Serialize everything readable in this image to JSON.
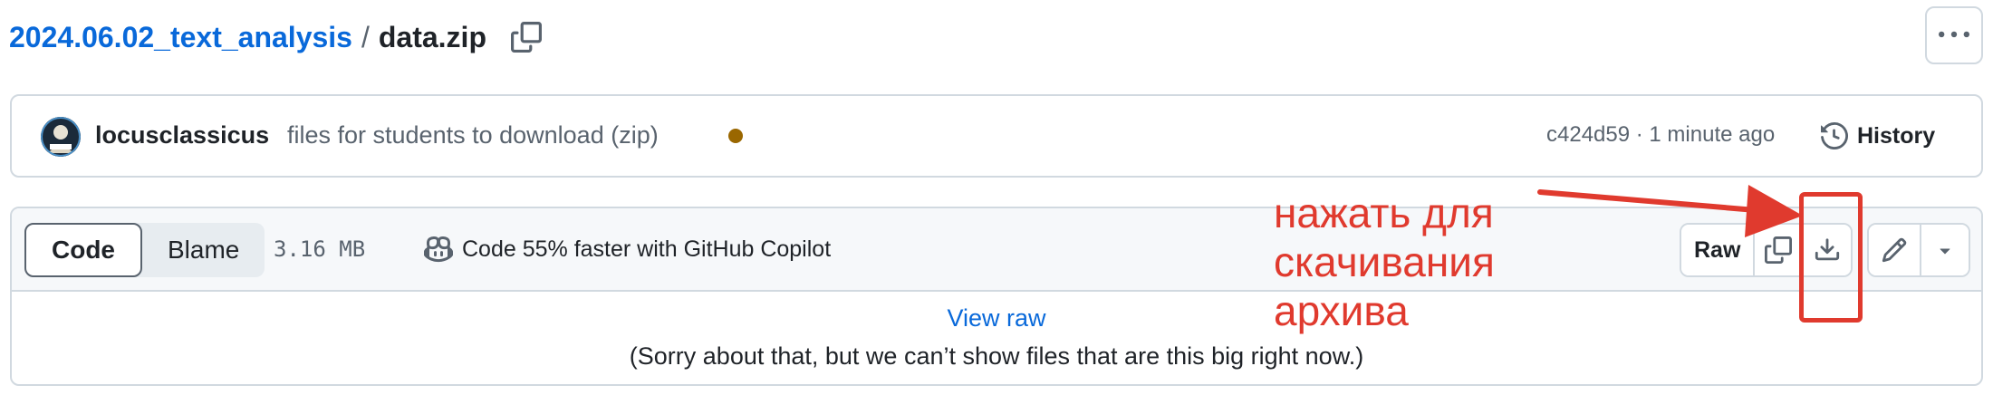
{
  "breadcrumb": {
    "repo": "2024.06.02_text_analysis",
    "separator": "/",
    "file": "data.zip"
  },
  "commit": {
    "author": "locusclassicus",
    "message": "files for students to download (zip)",
    "status_color": "#9a6700",
    "meta": "c424d59 · 1 minute ago",
    "history_label": "History"
  },
  "file": {
    "tabs": [
      {
        "label": "Code",
        "active": true
      },
      {
        "label": "Blame",
        "active": false
      }
    ],
    "size": "3.16 MB",
    "copilot_promo": "Code 55% faster with GitHub Copilot",
    "raw_label": "Raw",
    "view_raw": "View raw",
    "message": "(Sorry about that, but we can’t show files that are this big right now.)"
  },
  "icons": [
    "copy-icon",
    "kebab-icon",
    "history-icon",
    "copilot-icon",
    "download-icon",
    "pencil-icon",
    "triangle-down-icon"
  ],
  "annotation": {
    "lines": [
      "нажать для",
      "скачивания",
      "архива"
    ],
    "color": "#e03a2e"
  },
  "colors": {
    "link": "#0969da",
    "border": "#d1d9e0",
    "toolbar_bg": "#f6f8fa",
    "muted": "#59636e"
  }
}
